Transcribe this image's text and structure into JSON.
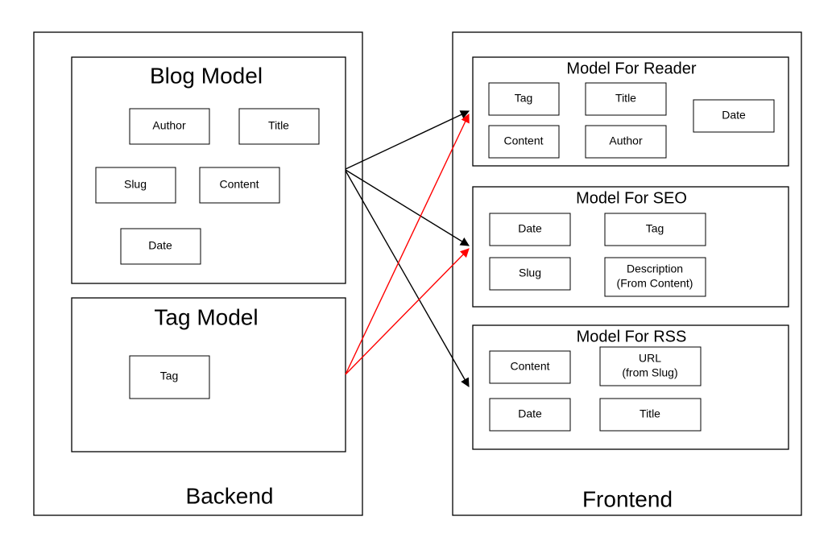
{
  "backend": {
    "label": "Backend",
    "blogModel": {
      "title": "Blog Model",
      "fields": {
        "author": "Author",
        "title": "Title",
        "slug": "Slug",
        "content": "Content",
        "date": "Date"
      }
    },
    "tagModel": {
      "title": "Tag Model",
      "fields": {
        "tag": "Tag"
      }
    }
  },
  "frontend": {
    "label": "Frontend",
    "readerModel": {
      "title": "Model For Reader",
      "fields": {
        "tag": "Tag",
        "title": "Title",
        "date": "Date",
        "content": "Content",
        "author": "Author"
      }
    },
    "seoModel": {
      "title": "Model For SEO",
      "fields": {
        "date": "Date",
        "tag": "Tag",
        "slug": "Slug",
        "description1": "Description",
        "description2": "(From Content)"
      }
    },
    "rssModel": {
      "title": "Model For RSS",
      "fields": {
        "content": "Content",
        "url1": "URL",
        "url2": "(from Slug)",
        "date": "Date",
        "title": "Title"
      }
    }
  },
  "arrows": {
    "blackColor": "#000000",
    "redColor": "#ff0000"
  }
}
